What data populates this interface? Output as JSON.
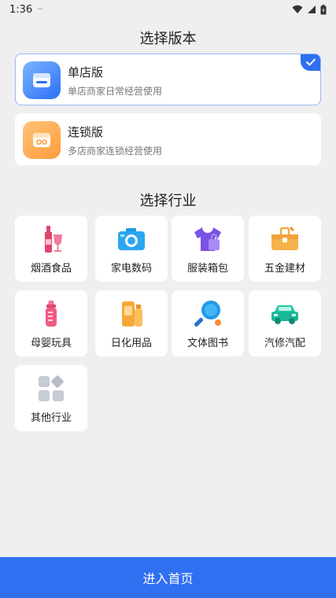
{
  "status_bar": {
    "time": "1:36",
    "extra": "···"
  },
  "version_section": {
    "title": "选择版本",
    "options": [
      {
        "name": "单店版",
        "desc": "单店商家日常经营使用",
        "selected": true,
        "icon": "store-icon",
        "color": "#2f6ff0"
      },
      {
        "name": "连锁版",
        "desc": "多店商家连锁经营使用",
        "selected": false,
        "icon": "chain-store-icon",
        "color": "#ff9c3a"
      }
    ]
  },
  "industry_section": {
    "title": "选择行业",
    "items": [
      {
        "label": "烟酒食品",
        "icon": "wine-bottle-icon"
      },
      {
        "label": "家电数码",
        "icon": "camera-icon"
      },
      {
        "label": "服装箱包",
        "icon": "clothing-icon"
      },
      {
        "label": "五金建材",
        "icon": "toolbox-icon"
      },
      {
        "label": "母婴玩具",
        "icon": "baby-bottle-icon"
      },
      {
        "label": "日化用品",
        "icon": "toiletries-icon"
      },
      {
        "label": "文体图书",
        "icon": "ping-pong-icon"
      },
      {
        "label": "汽修汽配",
        "icon": "car-icon"
      },
      {
        "label": "其他行业",
        "icon": "grid-icon"
      }
    ]
  },
  "footer": {
    "enter_label": "进入首页"
  },
  "colors": {
    "accent": "#2f6ff0",
    "background": "#efefef"
  }
}
